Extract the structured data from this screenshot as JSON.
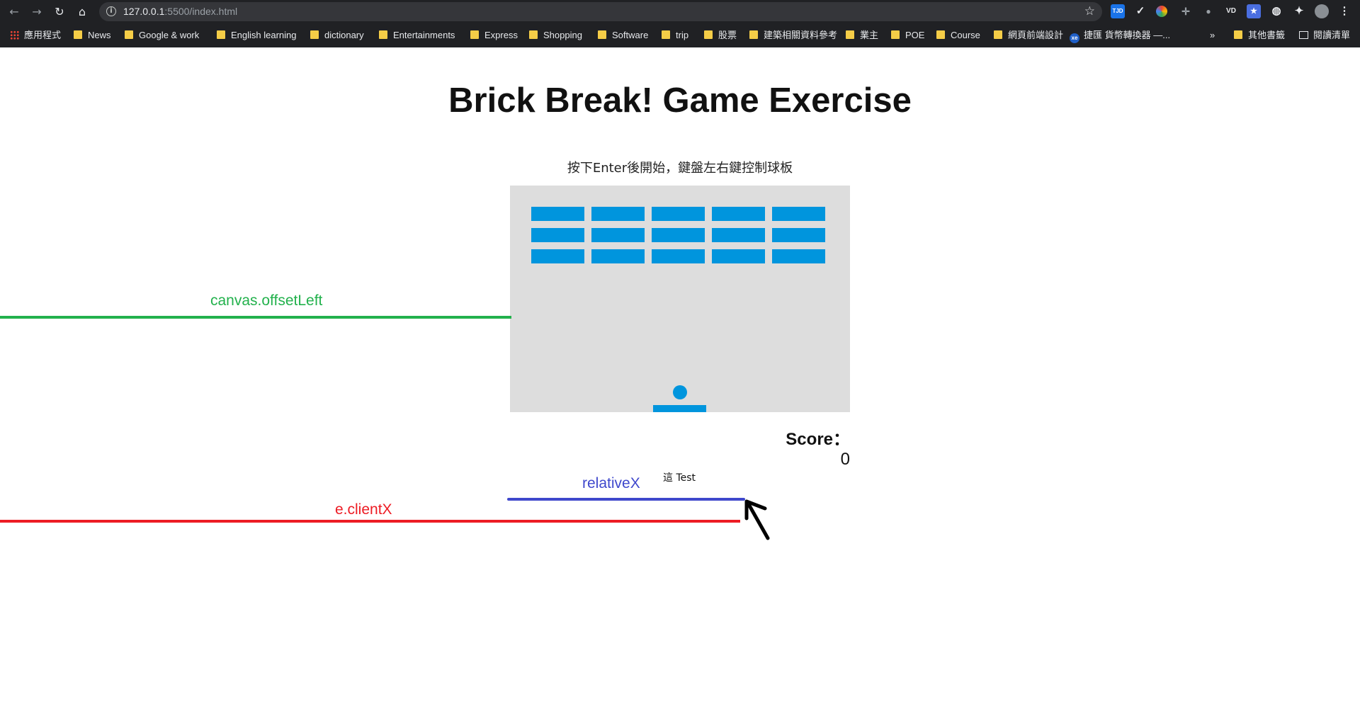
{
  "browser": {
    "url_host": "127.0.0.1",
    "url_rest": ":5500/index.html",
    "extensions": [
      "TJD",
      "check",
      "color-wheel",
      "grid",
      "pin",
      "VD",
      "bookmark-star",
      "globe",
      "puzzle",
      "avatar",
      "more"
    ],
    "bookmarks": [
      {
        "label": "應用程式",
        "type": "apps"
      },
      {
        "label": "News",
        "type": "folder"
      },
      {
        "label": "Google & work",
        "type": "folder"
      },
      {
        "label": "English learning",
        "type": "folder"
      },
      {
        "label": "dictionary",
        "type": "folder"
      },
      {
        "label": "Entertainments",
        "type": "folder"
      },
      {
        "label": "Express",
        "type": "folder"
      },
      {
        "label": "Shopping",
        "type": "folder"
      },
      {
        "label": "Software",
        "type": "folder"
      },
      {
        "label": "trip",
        "type": "folder"
      },
      {
        "label": "股票",
        "type": "folder"
      },
      {
        "label": "建築相關資料參考",
        "type": "folder"
      },
      {
        "label": "業主",
        "type": "folder"
      },
      {
        "label": "POE",
        "type": "folder"
      },
      {
        "label": "Course",
        "type": "folder"
      },
      {
        "label": "網頁前端設計",
        "type": "folder"
      },
      {
        "label": "捷匯 貨幣轉換器 —...",
        "type": "xe"
      }
    ],
    "bookmarks_overflow": "»",
    "other_bookmarks": "其他書籤",
    "reading_list": "閱讀清單"
  },
  "page": {
    "title": "Brick Break! Game Exercise",
    "instructions": "按下Enter後開始，鍵盤左右鍵控制球板",
    "score_label": "Score：",
    "score_value": "0",
    "test_label": "這 Test"
  },
  "game": {
    "brick_rows": 3,
    "brick_columns": 5,
    "brick_color": "#0095dd",
    "canvas_color": "#dddddd"
  },
  "annotations": {
    "offset_left": {
      "label": "canvas.offsetLeft",
      "color": "#22b14c"
    },
    "relative_x": {
      "label": "relativeX",
      "color": "#3f48cc"
    },
    "client_x": {
      "label": "e.clientX",
      "color": "#ed1c24"
    },
    "cursor_icon": "mouse-pointer-arrow"
  }
}
